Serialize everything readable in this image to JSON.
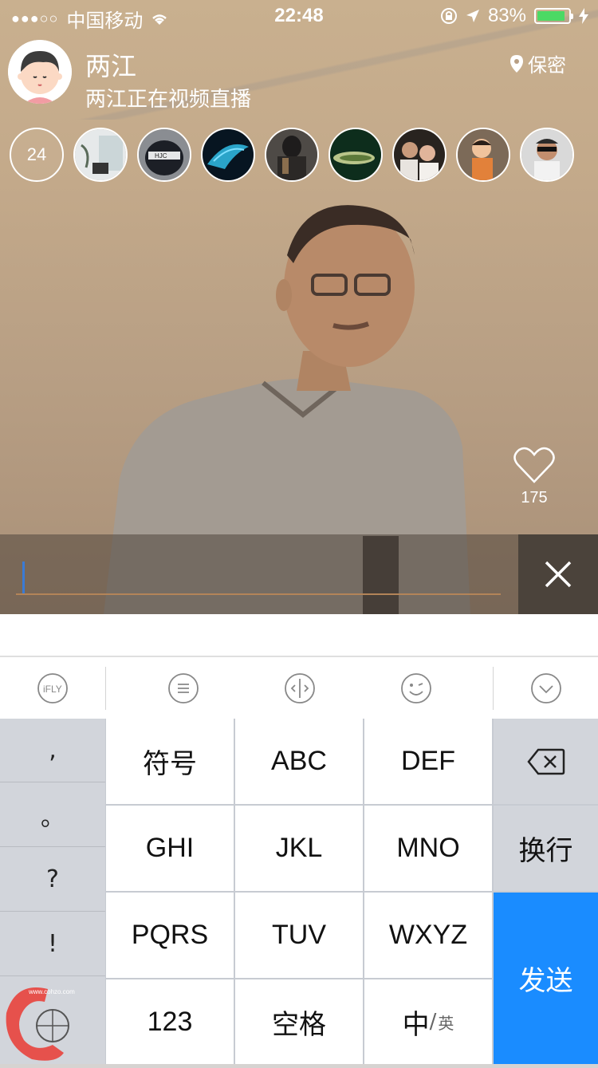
{
  "status_bar": {
    "carrier": "中国移动",
    "time": "22:48",
    "battery_percent": "83%"
  },
  "header": {
    "host_name": "两江",
    "host_subtitle": "两江正在视频直播",
    "location_label": "保密"
  },
  "viewers": {
    "count": "24",
    "avatars": [
      "viewer-1",
      "viewer-2",
      "viewer-3",
      "viewer-4",
      "viewer-5",
      "viewer-6",
      "viewer-7",
      "viewer-8"
    ]
  },
  "like": {
    "count": "175"
  },
  "comment_input": {
    "value": "",
    "placeholder": ""
  },
  "toolbar": {
    "ifly_label": "iFLY"
  },
  "keyboard": {
    "punctuation": [
      ",",
      "。",
      "?",
      "!"
    ],
    "rows": [
      [
        "符号",
        "ABC",
        "DEF"
      ],
      [
        "GHI",
        "JKL",
        "MNO"
      ],
      [
        "PQRS",
        "TUV",
        "WXYZ"
      ],
      [
        "123",
        "空格",
        "中"
      ]
    ],
    "lang_secondary": "英",
    "return_label": "换行",
    "send_label": "发送"
  },
  "watermark": {
    "site": "www.cohzo.com"
  },
  "colors": {
    "send_blue": "#1a8cff",
    "battery_green": "#4cd964",
    "cursor_blue": "#3a7bd5"
  }
}
